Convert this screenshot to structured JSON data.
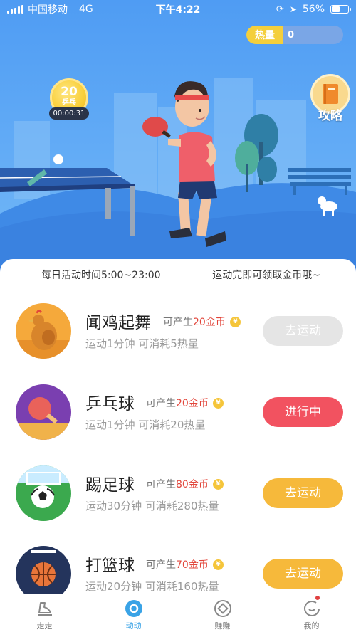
{
  "status_bar": {
    "carrier": "中国移动",
    "network": "4G",
    "time": "下午4:22",
    "battery": "56%",
    "battery_level": 0.56
  },
  "hero": {
    "heat_label": "热量",
    "heat_value": "0",
    "coin_badge": {
      "number": "20",
      "label": "乒乓"
    },
    "timer": "00:00:31",
    "guide_label": "攻略",
    "icons": [
      "book-icon",
      "ping-pong-player",
      "dog"
    ]
  },
  "info": {
    "hours": "每日活动时间5:00~23:00",
    "tip": "运动完即可领取金币哦~"
  },
  "activities": [
    {
      "title": "闻鸡起舞",
      "reward_prefix": "可产生",
      "reward_amount": "20金币",
      "desc": "运动1分钟 可消耗5热量",
      "button": "去运动",
      "state": "disabled",
      "icon": "chicken-icon"
    },
    {
      "title": "乒乓球",
      "reward_prefix": "可产生",
      "reward_amount": "20金币",
      "desc": "运动1分钟 可消耗20热量",
      "button": "进行中",
      "state": "active",
      "icon": "ping-pong-icon"
    },
    {
      "title": "踢足球",
      "reward_prefix": "可产生",
      "reward_amount": "80金币",
      "desc": "运动30分钟 可消耗280热量",
      "button": "去运动",
      "state": "available",
      "icon": "soccer-icon"
    },
    {
      "title": "打篮球",
      "reward_prefix": "可产生",
      "reward_amount": "70金币",
      "desc": "运动20分钟 可消耗160热量",
      "button": "去运动",
      "state": "available",
      "icon": "basketball-icon"
    }
  ],
  "colors": {
    "disabled_button": "#e5e5e5",
    "active_button": "#f25260",
    "available_button": "#f6b93b",
    "accent": "#3aa3e6",
    "reward_red": "#e2463b"
  },
  "tabbar": {
    "tabs": [
      {
        "label": "走走",
        "icon": "shoe-icon"
      },
      {
        "label": "动动",
        "icon": "activity-icon",
        "active": true
      },
      {
        "label": "赚赚",
        "icon": "coin-diamond-icon"
      },
      {
        "label": "我的",
        "icon": "profile-icon"
      }
    ]
  }
}
